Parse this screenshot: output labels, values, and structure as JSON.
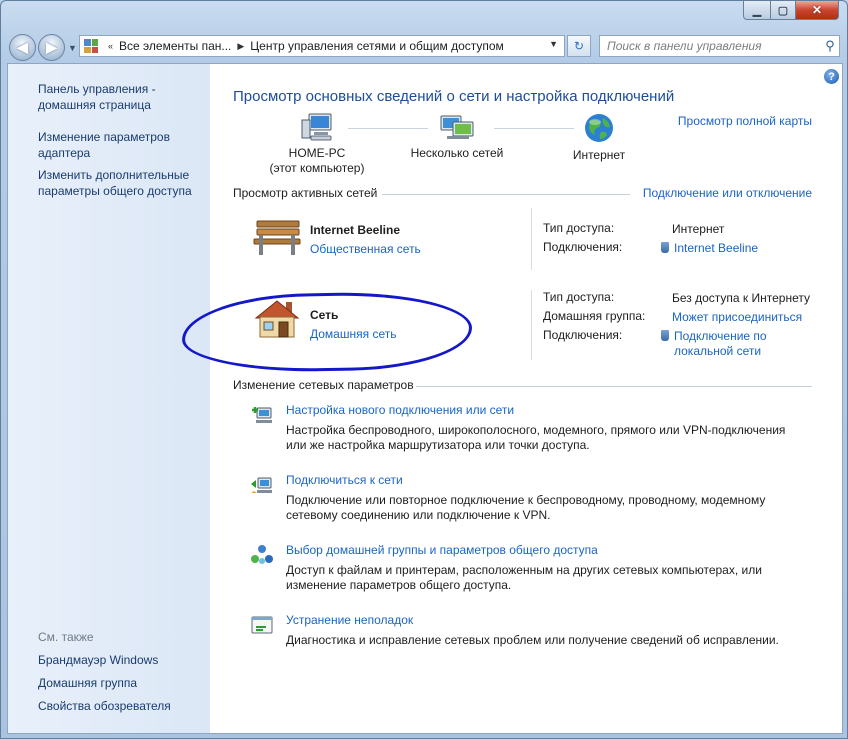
{
  "window": {
    "address": {
      "segment1": "Все элементы пан...",
      "segment2": "Центр управления сетями и общим доступом"
    },
    "search_placeholder": "Поиск в панели управления"
  },
  "sidebar": {
    "links": [
      {
        "label": "Панель управления - домашняя страница"
      },
      {
        "label": "Изменение параметров адаптера"
      },
      {
        "label": "Изменить дополнительные параметры общего доступа"
      }
    ],
    "see_also_title": "См. также",
    "see_also": [
      {
        "label": "Брандмауэр Windows"
      },
      {
        "label": "Домашняя группа"
      },
      {
        "label": "Свойства обозревателя"
      }
    ]
  },
  "main": {
    "heading": "Просмотр основных сведений о сети и настройка подключений",
    "full_map_link": "Просмотр полной карты",
    "map": {
      "pc_name": "HOME-PC",
      "pc_sub": "(этот компьютер)",
      "middle": "Несколько сетей",
      "internet": "Интернет"
    },
    "active_title": "Просмотр активных сетей",
    "connect_link": "Подключение или отключение",
    "networks": [
      {
        "name": "Internet Beeline",
        "type": "Общественная сеть",
        "access_label": "Тип доступа:",
        "access_value": "Интернет",
        "conn_label": "Подключения:",
        "conn_value": "Internet Beeline"
      },
      {
        "name": "Сеть",
        "type": "Домашняя сеть",
        "access_label": "Тип доступа:",
        "access_value": "Без доступа к Интернету",
        "group_label": "Домашняя группа:",
        "group_value": "Может присоединиться",
        "conn_label": "Подключения:",
        "conn_value_1": "Подключение по",
        "conn_value_2": "локальной сети"
      }
    ],
    "change_title": "Изменение сетевых параметров",
    "tasks": [
      {
        "title": "Настройка нового подключения или сети",
        "desc": "Настройка беспроводного, широкополосного, модемного, прямого или VPN-подключения или же настройка маршрутизатора или точки доступа."
      },
      {
        "title": "Подключиться к сети",
        "desc": "Подключение или повторное подключение к беспроводному, проводному, модемному сетевому соединению или подключение к VPN."
      },
      {
        "title": "Выбор домашней группы и параметров общего доступа",
        "desc": "Доступ к файлам и принтерам, расположенным на других сетевых компьютерах, или изменение параметров общего доступа."
      },
      {
        "title": "Устранение неполадок",
        "desc": "Диагностика и исправление сетевых проблем или получение сведений об исправлении."
      }
    ]
  }
}
